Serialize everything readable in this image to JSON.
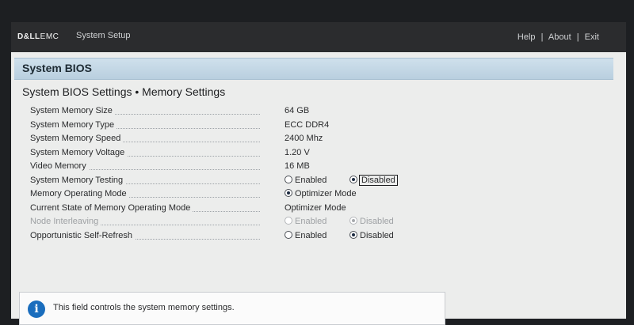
{
  "brand": {
    "logo_main": "D&LL",
    "logo_emc": "EMC"
  },
  "header": {
    "app_title": "System Setup",
    "links": [
      "Help",
      "About",
      "Exit"
    ],
    "separator": "|"
  },
  "section": {
    "title": "System BIOS"
  },
  "page": {
    "title": "System BIOS Settings • Memory Settings"
  },
  "rows": [
    {
      "label": "System Memory Size",
      "value": "64 GB"
    },
    {
      "label": "System Memory Type",
      "value": "ECC DDR4"
    },
    {
      "label": "System Memory Speed",
      "value": "2400 Mhz"
    },
    {
      "label": "System Memory Voltage",
      "value": "1.20 V"
    },
    {
      "label": "Video Memory",
      "value": "16 MB"
    },
    {
      "label": "System Memory Testing",
      "options": [
        "Enabled",
        "Disabled"
      ],
      "selected": "Disabled"
    },
    {
      "label": "Memory Operating Mode",
      "value": "Optimizer Mode"
    },
    {
      "label": "Current State of Memory Operating Mode",
      "value": "Optimizer Mode"
    },
    {
      "label": "Node Interleaving",
      "options": [
        "Enabled",
        "Disabled"
      ],
      "selected": "Disabled"
    },
    {
      "label": "Opportunistic Self-Refresh",
      "options": [
        "Enabled",
        "Disabled"
      ],
      "selected": "Disabled"
    }
  ],
  "help": {
    "icon": "info-icon",
    "message": "This field controls the system memory settings."
  },
  "colors": {
    "topbar": "#2b2c2e",
    "section_header": "#c5d8e6",
    "info_icon": "#1a6dbd"
  }
}
